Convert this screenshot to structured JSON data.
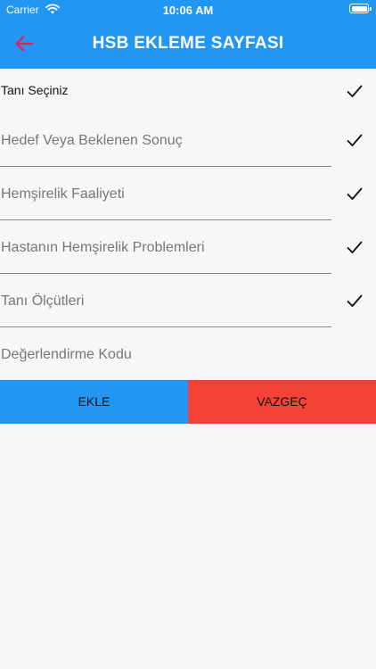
{
  "status_bar": {
    "carrier": "Carrier",
    "time": "10:06 AM",
    "wifi_icon": "wifi-icon",
    "battery_icon": "battery-icon"
  },
  "app_bar": {
    "title": "HSB EKLEME SAYFASI",
    "back_icon": "arrow-back-icon",
    "back_icon_color": "#e91e63",
    "background_color": "#2196f3"
  },
  "form": {
    "fields": [
      {
        "label": "Tanı Seçiniz",
        "checked": true
      },
      {
        "label": "Hedef Veya Beklenen Sonuç",
        "checked": true
      },
      {
        "label": "Hemşirelik Faaliyeti",
        "checked": true
      },
      {
        "label": "Hastanın Hemşirelik Problemleri",
        "checked": true
      },
      {
        "label": "Tanı Ölçütleri",
        "checked": true
      },
      {
        "label": "Değerlendirme Kodu",
        "checked": false
      }
    ]
  },
  "actions": {
    "add_label": "EKLE",
    "add_color": "#2196f3",
    "cancel_label": "VAZGEÇ",
    "cancel_color": "#f44336"
  }
}
